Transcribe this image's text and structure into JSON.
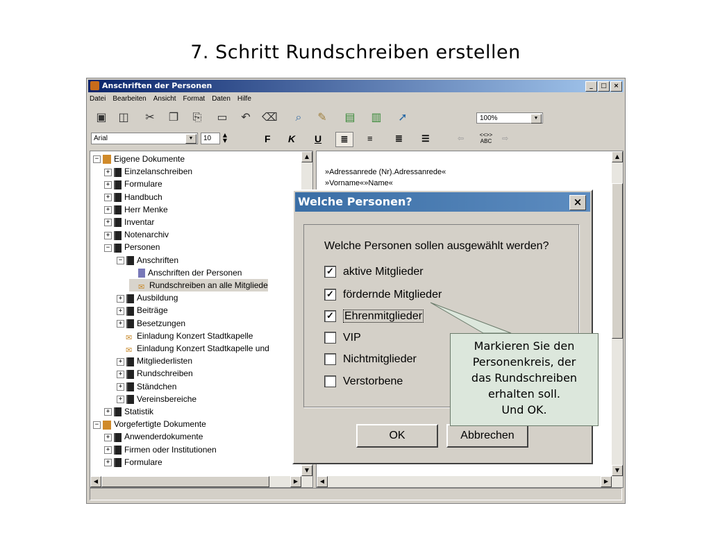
{
  "slide": {
    "title": "7. Schritt Rundschreiben erstellen"
  },
  "window": {
    "title": "Anschriften der Personen",
    "buttons": [
      "_",
      "□",
      "×"
    ],
    "menu": [
      "Datei",
      "Bearbeiten",
      "Ansicht",
      "Format",
      "Daten",
      "Hilfe"
    ],
    "toolbar_icons": [
      "save-icon",
      "save-all-icon",
      "cut-icon",
      "copy-icon",
      "paste-icon",
      "new-icon",
      "undo-icon",
      "trash-icon",
      "search-icon",
      "edit-icon",
      "print-preview-icon",
      "print-icon",
      "export-icon"
    ],
    "zoom": "100%",
    "font": "Arial",
    "font_size": "10",
    "format": {
      "bold": "F",
      "italic": "K",
      "underline": "U"
    },
    "field_button": "<<>> ABC",
    "status": ""
  },
  "tree": [
    {
      "label": "Eigene Dokumente",
      "level": 0,
      "expander": "−",
      "icon": "folder"
    },
    {
      "label": "Einzelanschreiben",
      "level": 1,
      "expander": "+",
      "icon": "book"
    },
    {
      "label": "Formulare",
      "level": 1,
      "expander": "+",
      "icon": "book"
    },
    {
      "label": "Handbuch",
      "level": 1,
      "expander": "+",
      "icon": "book"
    },
    {
      "label": "Herr Menke",
      "level": 1,
      "expander": "+",
      "icon": "book"
    },
    {
      "label": "Inventar",
      "level": 1,
      "expander": "+",
      "icon": "book"
    },
    {
      "label": "Notenarchiv",
      "level": 1,
      "expander": "+",
      "icon": "book"
    },
    {
      "label": "Personen",
      "level": 1,
      "expander": "−",
      "icon": "book"
    },
    {
      "label": "Anschriften",
      "level": 2,
      "expander": "−",
      "icon": "book"
    },
    {
      "label": "Anschriften der Personen",
      "level": 3,
      "expander": "",
      "icon": "doc"
    },
    {
      "label": "Rundschreiben an alle Mitgliede",
      "level": 3,
      "expander": "",
      "icon": "letter",
      "selected": true
    },
    {
      "label": "Ausbildung",
      "level": 2,
      "expander": "+",
      "icon": "book"
    },
    {
      "label": "Beiträge",
      "level": 2,
      "expander": "+",
      "icon": "book"
    },
    {
      "label": "Besetzungen",
      "level": 2,
      "expander": "+",
      "icon": "book"
    },
    {
      "label": "Einladung Konzert Stadtkapelle",
      "level": 2,
      "expander": "",
      "icon": "letter"
    },
    {
      "label": "Einladung Konzert Stadtkapelle und",
      "level": 2,
      "expander": "",
      "icon": "letter"
    },
    {
      "label": "Mitgliederlisten",
      "level": 2,
      "expander": "+",
      "icon": "book"
    },
    {
      "label": "Rundschreiben",
      "level": 2,
      "expander": "+",
      "icon": "book"
    },
    {
      "label": "Ständchen",
      "level": 2,
      "expander": "+",
      "icon": "book"
    },
    {
      "label": "Vereinsbereiche",
      "level": 2,
      "expander": "+",
      "icon": "book"
    },
    {
      "label": "Statistik",
      "level": 1,
      "expander": "+",
      "icon": "book"
    },
    {
      "label": "Vorgefertigte Dokumente",
      "level": 0,
      "expander": "−",
      "icon": "folder"
    },
    {
      "label": "Anwenderdokumente",
      "level": 1,
      "expander": "+",
      "icon": "book"
    },
    {
      "label": "Firmen oder Institutionen",
      "level": 1,
      "expander": "+",
      "icon": "book"
    },
    {
      "label": "Formulare",
      "level": 1,
      "expander": "+",
      "icon": "book"
    }
  ],
  "document": {
    "lines": [
      "»Adressanrede (Nr).Adressanrede«",
      "»Vorname«»Name«"
    ]
  },
  "dialog": {
    "title": "Welche Personen?",
    "close": "×",
    "question": "Welche Personen sollen ausgewählt werden?",
    "options": [
      {
        "label": "aktive Mitglieder",
        "checked": true
      },
      {
        "label": "fördernde Mitglieder",
        "checked": true
      },
      {
        "label": "Ehrenmitglieder",
        "checked": true,
        "focused": true
      },
      {
        "label": "VIP",
        "checked": false
      },
      {
        "label": "Nichtmitglieder",
        "checked": false
      },
      {
        "label": "Verstorbene",
        "checked": false
      }
    ],
    "ok": "OK",
    "cancel": "Abbrechen"
  },
  "callout": {
    "lines": [
      "Markieren Sie den",
      "Personenkreis, der",
      "das Rundschreiben",
      "erhalten soll.",
      "Und OK."
    ]
  }
}
